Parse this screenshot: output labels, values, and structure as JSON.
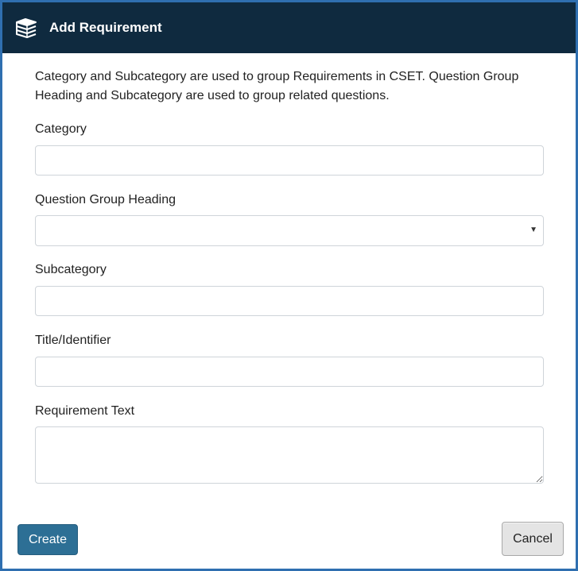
{
  "dialog": {
    "title": "Add Requirement",
    "icon": "books-icon",
    "intro": "Category and Subcategory are used to group Requirements in CSET. Question Group Heading and Subcategory are used to group related questions."
  },
  "fields": {
    "category": {
      "label": "Category",
      "value": ""
    },
    "question_group_heading": {
      "label": "Question Group Heading",
      "selected": ""
    },
    "subcategory": {
      "label": "Subcategory",
      "value": ""
    },
    "title_identifier": {
      "label": "Title/Identifier",
      "value": ""
    },
    "requirement_text": {
      "label": "Requirement Text",
      "value": ""
    }
  },
  "buttons": {
    "create": "Create",
    "cancel": "Cancel"
  },
  "colors": {
    "header_bg": "#0f2a3f",
    "border_accent": "#2f6fb0",
    "create_bg": "#2d6f95",
    "cancel_bg": "#e4e4e4"
  }
}
